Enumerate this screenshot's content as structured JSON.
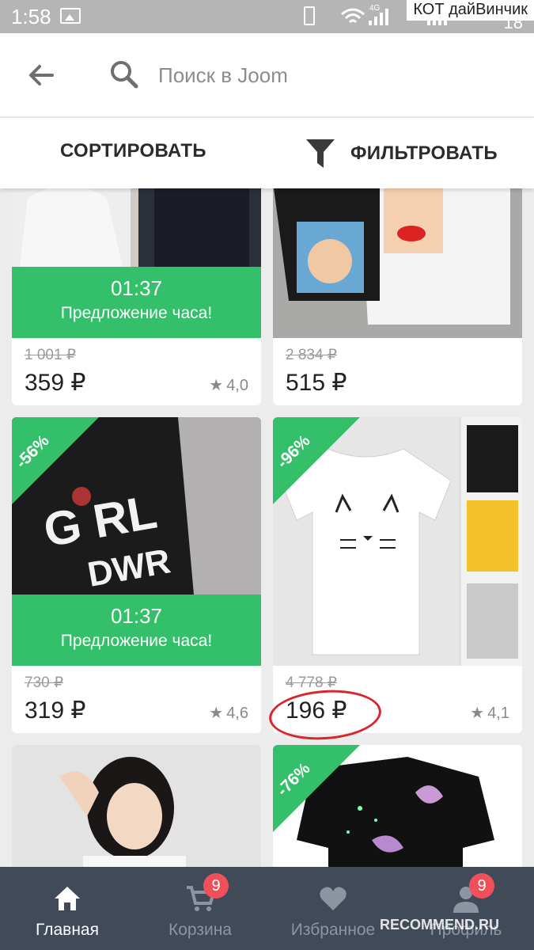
{
  "status_bar": {
    "time": "1:58",
    "network": "4G",
    "battery": "18",
    "watermark": "КОТ дайВинчик"
  },
  "search": {
    "placeholder": "Поиск в Joom"
  },
  "toolbar": {
    "sort_label": "СОРТИРОВАТЬ",
    "filter_label": "ФИЛЬТРОВАТЬ"
  },
  "products": [
    {
      "timer": "01:37",
      "offer": "Предложение часа!",
      "old_price": "1 001 ₽",
      "price": "359 ₽",
      "rating": "4,0"
    },
    {
      "old_price": "2 834 ₽",
      "price": "515 ₽"
    },
    {
      "discount": "-56%",
      "timer": "01:37",
      "offer": "Предложение часа!",
      "old_price": "730 ₽",
      "price": "319 ₽",
      "rating": "4,6"
    },
    {
      "discount": "-96%",
      "old_price": "4 778 ₽",
      "price": "196 ₽",
      "rating": "4,1"
    },
    {},
    {
      "discount": "-76%"
    }
  ],
  "bottom_nav": {
    "items": [
      {
        "label": "Главная",
        "icon": "home-icon"
      },
      {
        "label": "Корзина",
        "icon": "cart-icon",
        "badge": "9"
      },
      {
        "label": "Избранное",
        "icon": "heart-icon"
      },
      {
        "label": "Профиль",
        "icon": "profile-icon",
        "badge": "9"
      }
    ],
    "watermark": "RECOMMEND.RU"
  },
  "colors": {
    "accent_green": "#34c06a",
    "nav_bg": "#414a59",
    "badge_red": "#f0505a"
  }
}
